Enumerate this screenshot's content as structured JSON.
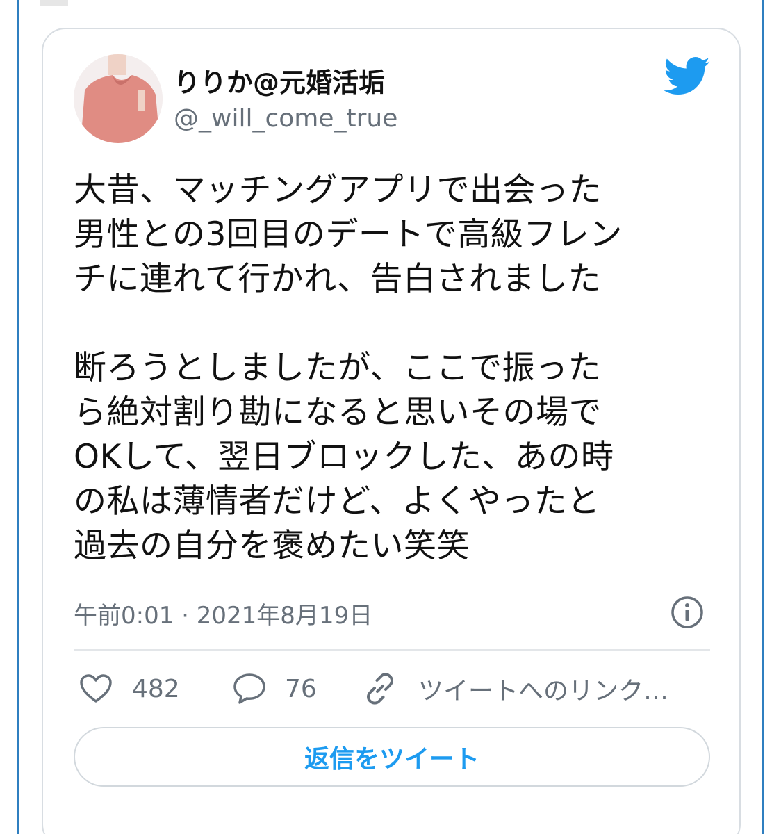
{
  "tweet": {
    "display_name": "りりか@元婚活垢",
    "handle": "@_will_come_true",
    "text": "大昔、マッチングアプリで出会った\n男性との3回目のデートで高級フレン\nチに連れて行かれ、告白されました\n\n断ろうとしましたが、ここで振った\nら絶対割り勘になると思いその場で\nOKして、翌日ブロックした、あの時\nの私は薄情者だけど、よくやったと\n過去の自分を褒めたい笑笑",
    "timestamp": "午前0:01 · 2021年8月19日"
  },
  "actions": {
    "likes": "482",
    "replies": "76",
    "link_label": "ツイートへのリンク…"
  },
  "reply_button_label": "返信をツイート",
  "colors": {
    "accent": "#1d9bf0",
    "text": "#111111",
    "muted": "#67707a",
    "border": "#d8dde2",
    "edge": "#2f7fc0"
  },
  "icons": {
    "brand": "twitter-bird-icon",
    "info": "info-icon",
    "like": "heart-icon",
    "reply": "speech-bubble-icon",
    "link": "link-icon"
  }
}
